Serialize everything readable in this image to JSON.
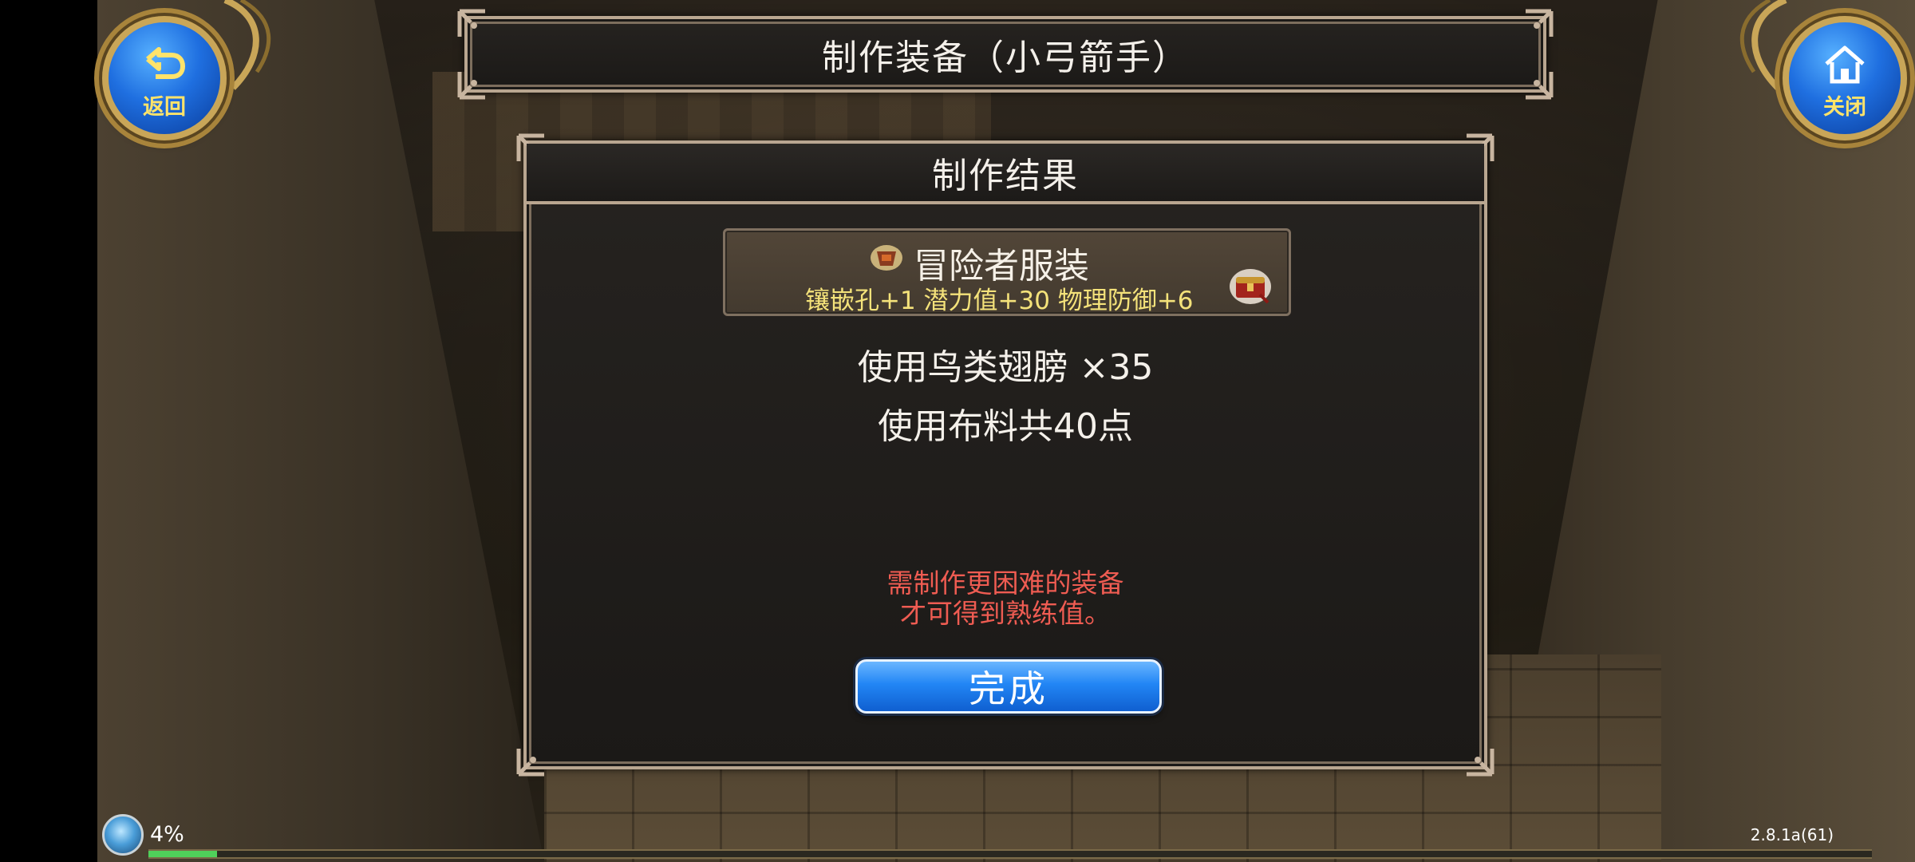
{
  "header": {
    "title": "制作装备（小弓箭手）"
  },
  "nav": {
    "back_label": "返回",
    "close_label": "关闭"
  },
  "result": {
    "header": "制作结果",
    "item": {
      "name": "冒险者服装",
      "stats": "镶嵌孔+1 潜力值+30 物理防御+6"
    },
    "line1": "使用鸟类翅膀 ×35",
    "line2": "使用布料共40点",
    "hint_line1": "需制作更困难的装备",
    "hint_line2": "才可得到熟练值。",
    "done_label": "完成"
  },
  "status": {
    "percent_label": "4%",
    "progress_fraction": 0.04,
    "version": "2.8.1a(61)"
  },
  "colors": {
    "stat_yellow": "#f4e27a",
    "hint_red": "#ef5c52",
    "button_blue": "#2286f5",
    "frame_border": "#b9a690"
  },
  "icons": {
    "back": "return-arrow-icon",
    "close": "home-icon",
    "item": "leather-armor-icon",
    "chest": "treasure-chest-icon",
    "status": "orb-icon"
  }
}
